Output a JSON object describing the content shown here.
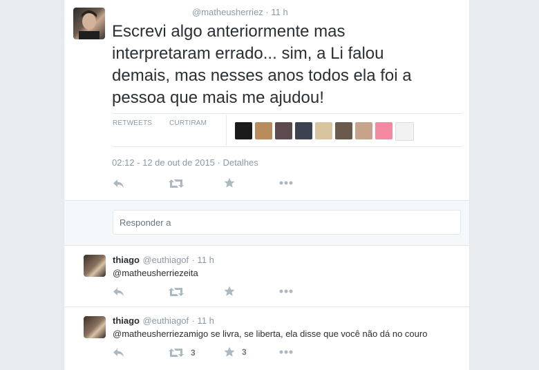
{
  "main_tweet": {
    "handle": "@matheusherriez",
    "time": "· 11 h",
    "text": "Escrevi algo anteriormente mas interpretaram errado... sim, a Li falou demais, mas nesses anos todos ela foi a pessoa que mais me ajudou!",
    "stats": {
      "retweets_label": "RETWEETS",
      "likes_label": "CURTIRAM"
    },
    "timestamp": "02:12 - 12 de out de 2015",
    "details_link": "· Detalhes",
    "liker_colors": [
      "#1b1b1b",
      "#b98d5b",
      "#5c4a4f",
      "#3c4250",
      "#d9c4a0",
      "#6a5a4c",
      "#c7a38a",
      "#f38aa2",
      "#f2f2f2"
    ]
  },
  "reply_box": {
    "placeholder": "Responder a"
  },
  "replies": [
    {
      "name": "thiago",
      "handle": "@euthiagof",
      "time": "· 11 h",
      "mention": "@matheusherriez",
      "text": "eita",
      "retweets": "",
      "likes": ""
    },
    {
      "name": "thiago",
      "handle": "@euthiagof",
      "time": "· 11 h",
      "mention": "@matheusherriez",
      "text": "amigo se livra, se liberta, ela disse que você não dá no couro",
      "retweets": "3",
      "likes": "3"
    }
  ],
  "colors": {
    "accent": "#55acee",
    "muted": "#8899a6",
    "icon": "#aab8c2"
  }
}
